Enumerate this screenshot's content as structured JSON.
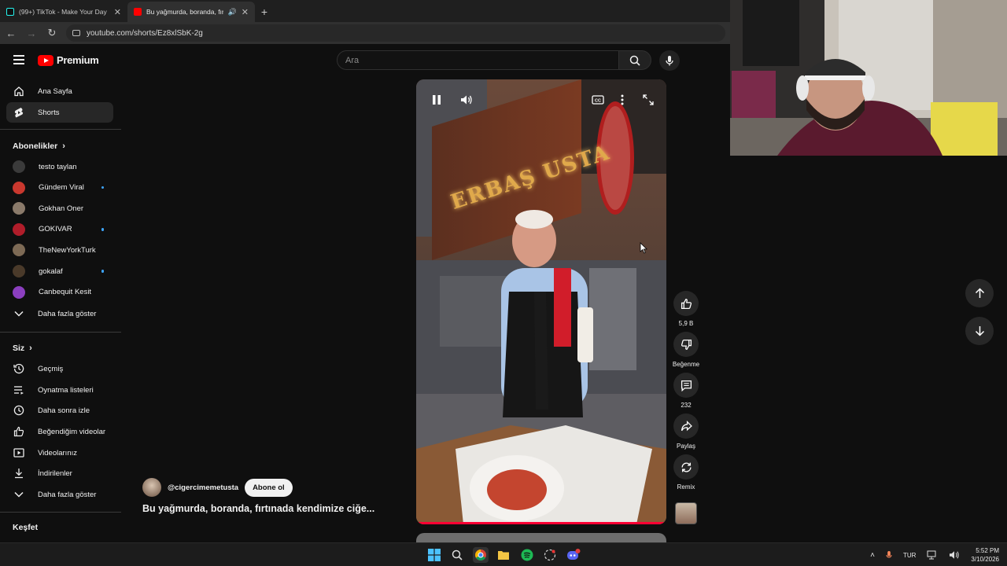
{
  "browser": {
    "tabs": [
      {
        "title": "(99+) TikTok - Make Your Day",
        "active": false
      },
      {
        "title": "Bu yağmurda, boranda, fırtı",
        "active": true
      }
    ],
    "new_tab_icon": "plus-icon",
    "url": "youtube.com/shorts/Ez8xlSbK-2g"
  },
  "header": {
    "brand": "Premium",
    "search_placeholder": "Ara"
  },
  "sidebar": {
    "main": [
      {
        "label": "Ana Sayfa",
        "icon": "home-icon"
      },
      {
        "label": "Shorts",
        "icon": "shorts-icon",
        "active": true
      }
    ],
    "subs_title": "Abonelikler",
    "subscriptions": [
      {
        "label": "testo taylan",
        "color": "#3b3b3b",
        "dot": false
      },
      {
        "label": "Gündem Viral",
        "color": "#c9382e",
        "dot": true
      },
      {
        "label": "Gokhan Oner",
        "color": "#8a7a6a",
        "dot": false
      },
      {
        "label": "GOKIVAR",
        "color": "#b01d2a",
        "dot": true
      },
      {
        "label": "TheNewYorkTurk",
        "color": "#7d6a55",
        "dot": false
      },
      {
        "label": "gokalaf",
        "color": "#4a3a2a",
        "dot": true
      },
      {
        "label": "Canbequit Kesit",
        "color": "#8b3fbf",
        "dot": false
      }
    ],
    "subs_more": "Daha fazla göster",
    "you_title": "Siz",
    "you": [
      {
        "label": "Geçmiş",
        "icon": "history-icon"
      },
      {
        "label": "Oynatma listeleri",
        "icon": "playlist-icon"
      },
      {
        "label": "Daha sonra izle",
        "icon": "clock-icon"
      },
      {
        "label": "Beğendiğim videolar",
        "icon": "thumbs-up-icon"
      },
      {
        "label": "Videolarınız",
        "icon": "video-icon"
      },
      {
        "label": "İndirilenler",
        "icon": "download-icon"
      }
    ],
    "you_more": "Daha fazla göster",
    "explore_title": "Keşfet"
  },
  "short": {
    "channel": "@cigercimemetusta",
    "subscribe": "Abone ol",
    "title": "Bu yağmurda, boranda, fırtınada kendimize ciğe...",
    "sign_text": "ERBAŞ USTA",
    "likes": "5,9 B",
    "dislike_label": "Beğenme",
    "comments": "232",
    "share_label": "Paylaş",
    "remix_label": "Remix",
    "progress": 1.0
  },
  "taskbar": {
    "language": "TUR",
    "time": "5:52 PM",
    "date": "3/10/2026"
  },
  "colors": {
    "background": "#0f0f0f",
    "accent": "#ff0000",
    "active_item": "#272727"
  }
}
